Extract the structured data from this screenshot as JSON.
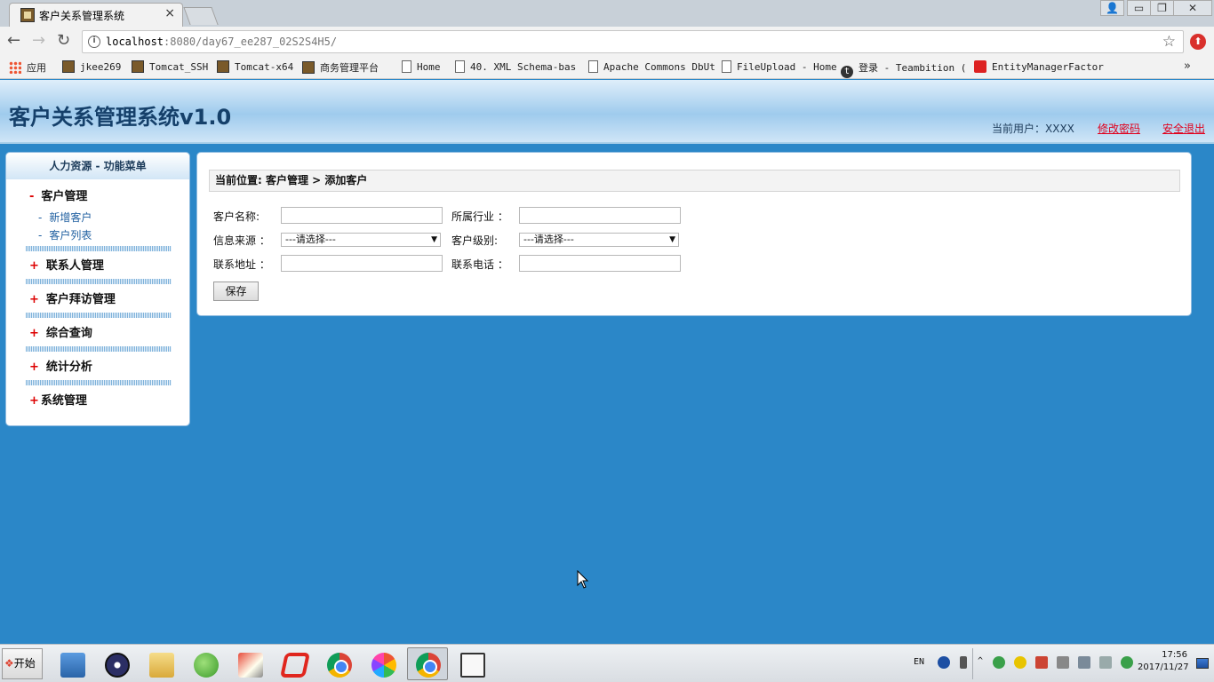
{
  "browser": {
    "tab_title": "客户关系管理系统",
    "tab_close": "×",
    "url_host": "localhost",
    "url_rest": ":8080/day67_ee287_02S2S4H5/",
    "window_controls": [
      "👤",
      "▭",
      "❐",
      "✕"
    ],
    "nav": {
      "back": "←",
      "forward": "→",
      "reload": "↻"
    },
    "info_glyph": "i",
    "star_glyph": "☆",
    "ext_glyph": "⬆"
  },
  "bookmarks": [
    {
      "label": "应用",
      "icon": "apps-grid-icon"
    },
    {
      "label": "jkee269",
      "icon": "tomcat-icon"
    },
    {
      "label": "Tomcat_SSH",
      "icon": "tomcat-icon"
    },
    {
      "label": "Tomcat-x64",
      "icon": "tomcat-icon"
    },
    {
      "label": "商务管理平台",
      "icon": "tomcat-icon"
    },
    {
      "label": "Home",
      "icon": "page-icon"
    },
    {
      "label": "40. XML Schema-bas",
      "icon": "page-icon"
    },
    {
      "label": "Apache Commons DbUt",
      "icon": "page-icon"
    },
    {
      "label": "FileUpload - Home",
      "icon": "page-icon"
    },
    {
      "label": "登录 - Teambition (",
      "icon": "teambition-icon"
    },
    {
      "label": "EntityManagerFactor",
      "icon": "oracle-icon"
    }
  ],
  "bookmarks_more": "»",
  "header": {
    "title": "客户关系管理系统v1.0",
    "current_user": "当前用户：XXXX",
    "change_password": "修改密码",
    "logout": "安全退出"
  },
  "sidebar": {
    "title": "人力资源  - 功能菜单",
    "groups": [
      {
        "sign": "-",
        "label": "客户管理",
        "expanded": true,
        "items": [
          "新增客户",
          "客户列表"
        ]
      },
      {
        "sign": "+",
        "label": "联系人管理"
      },
      {
        "sign": "+",
        "label": "客户拜访管理"
      },
      {
        "sign": "+",
        "label": "综合查询"
      },
      {
        "sign": "+",
        "label": "统计分析"
      },
      {
        "sign": "+",
        "label": "系统管理"
      }
    ],
    "sub_dash": "-"
  },
  "main": {
    "breadcrumb": "当前位置: 客户管理 > 添加客户",
    "form": {
      "customer_name_label": "客户名称:",
      "customer_name_value": "",
      "industry_label": "所属行业 ：",
      "industry_value": "",
      "source_label": "信息来源 ：",
      "source_selected": "---请选择---",
      "level_label": "客户级别:",
      "level_selected": "---请选择---",
      "address_label": "联系地址 ：",
      "address_value": "",
      "phone_label": "联系电话 ：",
      "phone_value": "",
      "save_label": "保存"
    }
  },
  "taskbar": {
    "start_label": "开始",
    "apps": [
      "network-icon",
      "eclipse-icon",
      "explorer-folder-icon",
      "green-app-icon",
      "eraser-app-icon",
      "foxit-icon",
      "chrome-icon",
      "pinwheel-icon",
      "chrome-active-icon",
      "document-app-icon"
    ],
    "lang": "EN",
    "clock_time": "17:56",
    "clock_date": "2017/11/27"
  },
  "colors": {
    "page_background": "#2b87c8",
    "header_title": "#15406a",
    "link_red": "#e0001c",
    "sidebar_sign": "#dd0000"
  }
}
